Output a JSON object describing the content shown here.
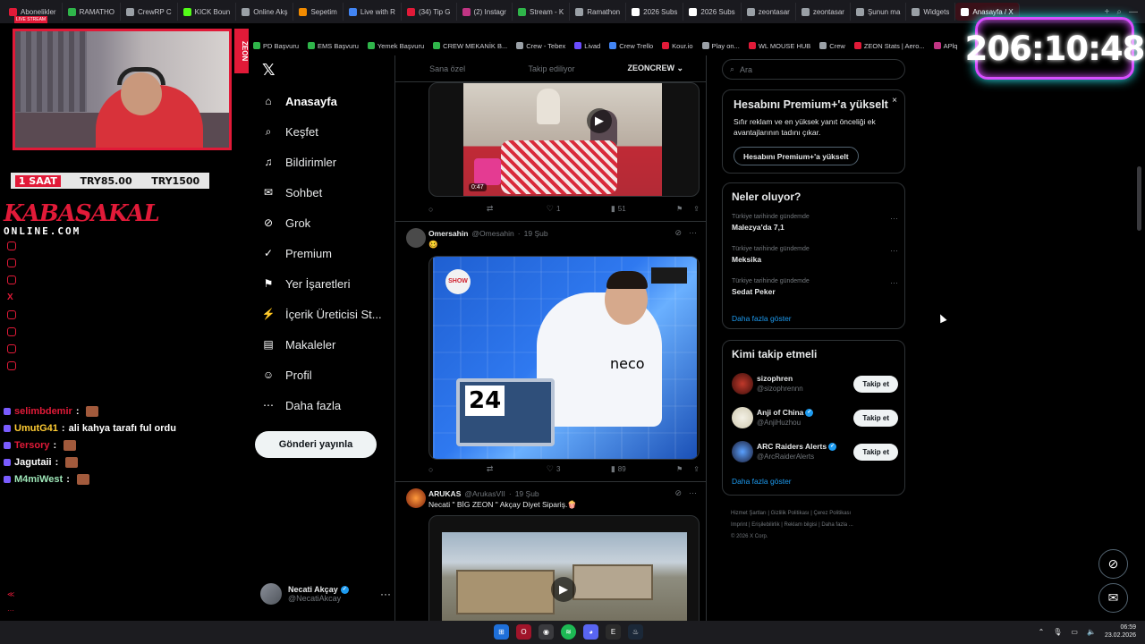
{
  "browser": {
    "tabs": [
      {
        "label": "Abonelikler",
        "color": "#e11a38"
      },
      {
        "label": "RAMATHO",
        "color": "#2fb54a"
      },
      {
        "label": "CrewRP C",
        "color": "#9aa0a6"
      },
      {
        "label": "KICK Boun",
        "color": "#53fc18"
      },
      {
        "label": "Online Akş",
        "color": "#9aa0a6"
      },
      {
        "label": "Sepetim",
        "color": "#f28b00"
      },
      {
        "label": "Live with R",
        "color": "#4285f4"
      },
      {
        "label": "(34) Tip G",
        "color": "#e11a38"
      },
      {
        "label": "(2) Instagr",
        "color": "#c13584"
      },
      {
        "label": "Stream - K",
        "color": "#2fb54a"
      },
      {
        "label": "Ramathon",
        "color": "#9aa0a6"
      },
      {
        "label": "2026 Subs",
        "color": "#fff"
      },
      {
        "label": "2026 Subs",
        "color": "#fff"
      },
      {
        "label": "zeontasar",
        "color": "#9aa0a6"
      },
      {
        "label": "zeontasar",
        "color": "#9aa0a6"
      },
      {
        "label": "Şunun ma",
        "color": "#9aa0a6"
      },
      {
        "label": "Widgets",
        "color": "#9aa0a6"
      },
      {
        "label": "Anasayfa / X",
        "color": "#fff",
        "active": true
      }
    ],
    "bookmarks": [
      "PD Başvuru",
      "EMS Başvuru",
      "Yemek Başvuru",
      "CREW MEKANİK B...",
      "Crew - Tebex",
      "Livad",
      "Crew Trello",
      "Kour.io",
      "Play on...",
      "WL MOUSE HUB",
      "Crew",
      "ZEON Stats | Aero...",
      "APlq"
    ]
  },
  "stream": {
    "live_label": "LIVE STREAM",
    "zeon_label": "ZEON",
    "sub_goal": {
      "duration": "1 SAAT",
      "price1": "TRY85.00",
      "price2": "TRY1500"
    },
    "brand_name": "KABASAKAL",
    "brand_domain": "ONLINE.COM",
    "timer": "206:10:48",
    "chat": [
      {
        "user": "selimbdemir",
        "message": "",
        "color": "#e11a38"
      },
      {
        "user": "UmutG41",
        "message": "ali kahya tarafı ful ordu",
        "color": "#ffcc33"
      },
      {
        "user": "Tersory",
        "message": "",
        "color": "#e11a38"
      },
      {
        "user": "Jagutaii",
        "message": "",
        "color": "#ffffff"
      },
      {
        "user": "M4miWest",
        "message": "",
        "color": "#9ee7b8"
      }
    ]
  },
  "nav": {
    "items": [
      {
        "label": "Anasayfa",
        "icon": "home-icon",
        "active": true
      },
      {
        "label": "Keşfet",
        "icon": "search-icon"
      },
      {
        "label": "Bildirimler",
        "icon": "bell-icon"
      },
      {
        "label": "Sohbet",
        "icon": "mail-icon"
      },
      {
        "label": "Grok",
        "icon": "grok-icon"
      },
      {
        "label": "Premium",
        "icon": "premium-icon"
      },
      {
        "label": "Yer İşaretleri",
        "icon": "bookmark-icon"
      },
      {
        "label": "İçerik Üreticisi St...",
        "icon": "creator-icon"
      },
      {
        "label": "Makaleler",
        "icon": "article-icon"
      },
      {
        "label": "Profil",
        "icon": "profile-icon"
      },
      {
        "label": "Daha fazla",
        "icon": "more-icon"
      }
    ],
    "post_button": "Gönderi yayınla",
    "profile": {
      "name": "Necati Akçay",
      "handle": "@NecatiAkcay"
    }
  },
  "feed": {
    "tabs": [
      "Sana özel",
      "Takip ediliyor",
      "ZEONCREW"
    ],
    "posts": [
      {
        "duration": "0:47",
        "replies": "",
        "reposts": "",
        "likes": "1",
        "views": "51"
      },
      {
        "name": "Omersahin",
        "handle": "@Omesahin",
        "date": "19 Şub",
        "text": "🥴",
        "media_caption": "neco",
        "media_number": "24",
        "media_logo": "SHOW",
        "replies": "",
        "reposts": "",
        "likes": "3",
        "views": "89"
      },
      {
        "name": "ARUKAS",
        "handle": "@ArukasVII",
        "date": "19 Şub",
        "text": "Necati \" BİG ZEON \" Akçay  Diyet Sipariş.🍿"
      }
    ]
  },
  "rail": {
    "search_placeholder": "Ara",
    "premium": {
      "title": "Hesabını Premium+'a yükselt",
      "desc": "Sıfır reklam ve en yüksek yanıt önceliği ek avantajlarının tadını çıkar.",
      "button": "Hesabını Premium+'a yükselt",
      "close": "×"
    },
    "trends_title": "Neler oluyor?",
    "trends": [
      {
        "context": "Türkiye tarihinde gündemde",
        "name": "Malezya'da 7,1"
      },
      {
        "context": "Türkiye tarihinde gündemde",
        "name": "Meksika"
      },
      {
        "context": "Türkiye tarihinde gündemde",
        "name": "Sedat Peker"
      }
    ],
    "show_more": "Daha fazla göster",
    "who_title": "Kimi takip etmeli",
    "follow": [
      {
        "name": "sizophren",
        "handle": "@sizophrennn",
        "verified": false,
        "button": "Takip et"
      },
      {
        "name": "Anji of China",
        "handle": "@AnjiHuzhou",
        "verified": true,
        "button": "Takip et"
      },
      {
        "name": "ARC Raiders Alerts",
        "handle": "@ArcRaiderAlerts",
        "verified": true,
        "button": "Takip et"
      }
    ],
    "footer": [
      "Hizmet Şartları",
      "Gizlilik Politikası",
      "Çerez Politikası",
      "Imprint",
      "Erişilebilirlik",
      "Reklam bilgisi",
      "Daha fazla ...",
      "© 2026 X Corp."
    ]
  },
  "taskbar": {
    "time": "06:59",
    "date": "23.02.2026"
  }
}
